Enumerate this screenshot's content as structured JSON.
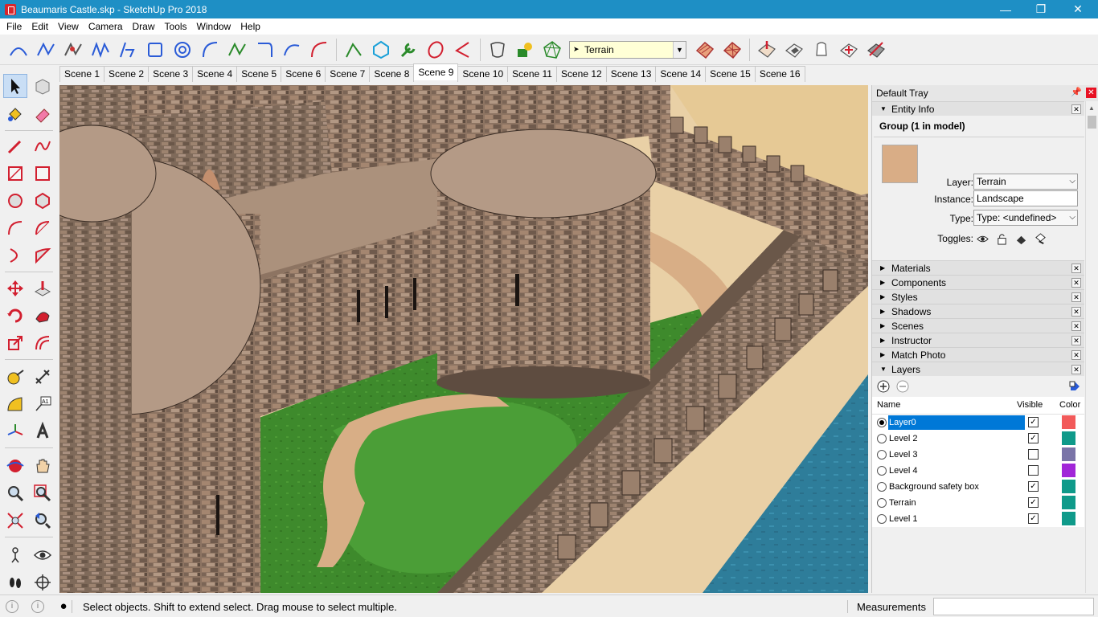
{
  "window": {
    "title": "Beaumaris Castle.skp - SketchUp Pro 2018",
    "minimize": "—",
    "maximize": "❐",
    "close": "✕"
  },
  "menu": [
    "File",
    "Edit",
    "View",
    "Camera",
    "Draw",
    "Tools",
    "Window",
    "Help"
  ],
  "toolbar": {
    "active_layer": "Terrain"
  },
  "scenes": [
    "Scene 1",
    "Scene 2",
    "Scene 3",
    "Scene 4",
    "Scene 5",
    "Scene 6",
    "Scene 7",
    "Scene 8",
    "Scene 9",
    "Scene 10",
    "Scene 11",
    "Scene 12",
    "Scene 13",
    "Scene 14",
    "Scene 15",
    "Scene 16"
  ],
  "active_scene": "Scene 9",
  "tray": {
    "title": "Default Tray",
    "entity_info": {
      "header": "Entity Info",
      "title": "Group (1 in model)",
      "layer_label": "Layer:",
      "layer_value": "Terrain",
      "instance_label": "Instance:",
      "instance_value": "Landscape",
      "type_label": "Type:",
      "type_value": "Type: <undefined>",
      "toggles_label": "Toggles:"
    },
    "panels": [
      "Materials",
      "Components",
      "Styles",
      "Shadows",
      "Scenes",
      "Instructor",
      "Match Photo"
    ],
    "layers": {
      "header": "Layers",
      "col_name": "Name",
      "col_visible": "Visible",
      "col_color": "Color",
      "rows": [
        {
          "name": "Layer0",
          "visible": true,
          "active": true,
          "color": "#f25a5a"
        },
        {
          "name": "Level 2",
          "visible": true,
          "active": false,
          "color": "#0f9a8a"
        },
        {
          "name": "Level 3",
          "visible": false,
          "active": false,
          "color": "#7a74a8"
        },
        {
          "name": "Level 4",
          "visible": false,
          "active": false,
          "color": "#a126d8"
        },
        {
          "name": "Background safety box",
          "visible": true,
          "active": false,
          "color": "#0f9a8a"
        },
        {
          "name": "Terrain",
          "visible": true,
          "active": false,
          "color": "#0f9a8a"
        },
        {
          "name": "Level 1",
          "visible": true,
          "active": false,
          "color": "#0f9a8a"
        }
      ]
    }
  },
  "status": {
    "text": "Select objects. Shift to extend select. Drag mouse to select multiple.",
    "measurements_label": "Measurements"
  }
}
